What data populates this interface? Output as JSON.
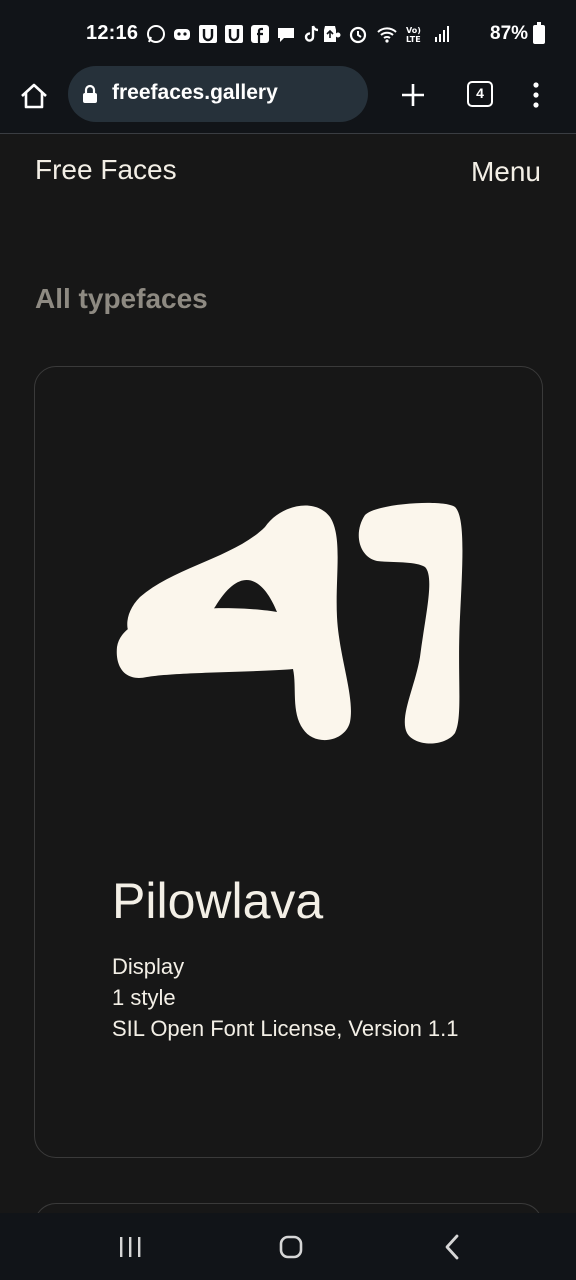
{
  "status_bar": {
    "time": "12:16",
    "battery": "87%",
    "notification_icons": [
      "whatsapp-icon",
      "discord-icon",
      "u-app-icon",
      "u-app-icon",
      "facebook-icon",
      "chat-icon",
      "tiktok-icon",
      "dot-icon"
    ],
    "system_icons": [
      "recycle-icon",
      "alarm-icon",
      "wifi-icon",
      "volte-icon",
      "signal-icon",
      "battery-icon"
    ]
  },
  "browser": {
    "url": "freefaces.gallery",
    "tab_count": "4"
  },
  "site": {
    "logo": "Free Faces",
    "menu_label": "Menu"
  },
  "section": {
    "title": "All typefaces"
  },
  "typeface_card": {
    "name": "Pilowlava",
    "specimen_glyphs": "A1",
    "category": "Display",
    "styles": "1 style",
    "license": "SIL Open Font License, Version 1.1"
  },
  "colors": {
    "background": "#171717",
    "text": "#f3efe6",
    "muted": "#8e8a82",
    "chrome": "#111418"
  }
}
